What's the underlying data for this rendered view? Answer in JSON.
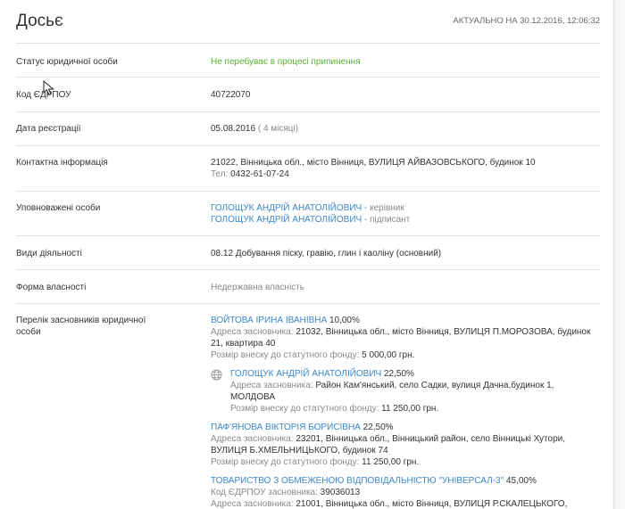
{
  "header": {
    "title": "Досьє",
    "updated": "АКТУАЛЬНО НА 30.12.2016, 12:06:32"
  },
  "status": {
    "label": "Статус юридичної особи",
    "value": "Не перебуває в процесі припинення",
    "color": "#5cb032"
  },
  "edrpou": {
    "label": "Код ЄДРПОУ",
    "value": "40722070"
  },
  "registration": {
    "label": "Дата реєстрації",
    "date": "05.08.2016",
    "age": "( 4 місяці)"
  },
  "contacts": {
    "label": "Контактна інформація",
    "address": "21022, Вінницька обл., місто Вінниця, ВУЛИЦЯ АЙВАЗОВСЬКОГО, будинок 10",
    "phone_label": "Тел:",
    "phone": "0432-61-07-24"
  },
  "authorized": {
    "label": "Уповноважені особи",
    "persons": [
      {
        "name": "ГОЛОЩУК АНДРІЙ АНАТОЛІЙОВИЧ",
        "role": " - керівник"
      },
      {
        "name": "ГОЛОЩУК АНДРІЙ АНАТОЛІЙОВИЧ",
        "role": " - підписант"
      }
    ]
  },
  "activities": {
    "label": "Види діяльності",
    "value": "08.12 Добування піску, гравію, глин і каоліну (основний)"
  },
  "ownership": {
    "label": "Форма власності",
    "value": "Недержавна власність"
  },
  "founders": {
    "label": "Перелік засновників юридичної особи",
    "items": [
      {
        "name": "ВОЙТОВА ІРИНА ІВАНІВНА",
        "share": " 10,00%",
        "addr_label": "Адреса засновника:",
        "addr": " 21032, Вінницька обл., місто Вінниця, ВУЛИЦЯ П.МОРОЗОВА, будинок 21, квартира 40",
        "contrib_label": "Розмір внеску до статутного фонду:",
        "contrib": " 5 000,00 грн."
      },
      {
        "name": "ГОЛОЩУК АНДРІЙ АНАТОЛІЙОВИЧ",
        "share": " 22,50%",
        "addr_label": "Адреса засновника:",
        "addr": " Район Кам'янський, село Садки, вулиця Дачна,будинок 1, МОЛДОВА",
        "contrib_label": "Розмір внеску до статутного фонду:",
        "contrib": " 11 250,00 грн.",
        "icon": "globe-icon"
      },
      {
        "name": "ПАФ'ЯНОВА ВІКТОРІЯ БОРИСІВНА",
        "share": " 22,50%",
        "addr_label": "Адреса засновника:",
        "addr": " 23201, Вінницька обл., Вінницький район, село Вінницькі Хутори, ВУЛИЦЯ Б.ХМЕЛЬНИЦЬКОГО, будинок 74",
        "contrib_label": "Розмір внеску до статутного фонду:",
        "contrib": " 11 250,00 грн."
      },
      {
        "name": "ТОВАРИСТВО З ОБМЕЖЕНОЮ ВІДПОВІДАЛЬНІСТЮ \"УНІВЕРСАЛ-3\"",
        "share": " 45,00%",
        "code_label": "Код ЄДРПОУ засновника:",
        "code": " 39036013",
        "addr_label": "Адреса засновника:",
        "addr": " 21001, Вінницька обл., місто Вінниця, ВУЛИЦЯ Р.СКАЛЕЦЬКОГО,"
      }
    ]
  }
}
